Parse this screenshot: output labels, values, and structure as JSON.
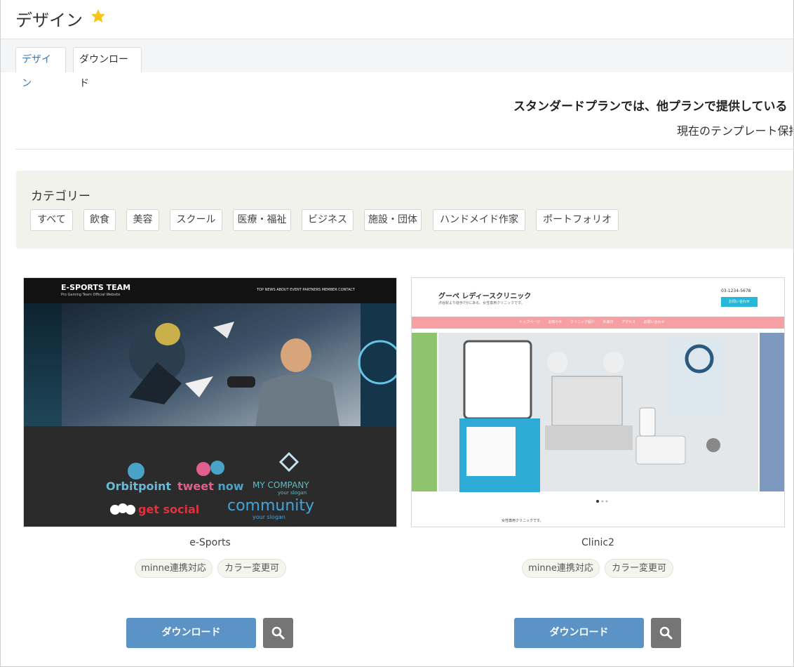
{
  "header": {
    "title": "デザイン",
    "star_icon": "star-icon",
    "star_color": "#f5c518"
  },
  "tabs": [
    {
      "label": "デザイン",
      "active": false
    },
    {
      "label": "ダウンロード",
      "active": true
    }
  ],
  "notice": {
    "line1": "スタンダードプランでは、他プランで提供している「有料",
    "line2": "現在のテンプレート保持"
  },
  "categories": {
    "title": "カテゴリー",
    "items": [
      "すべて",
      "飲食",
      "美容",
      "スクール",
      "医療・福祉",
      "ビジネス",
      "施設・団体",
      "ハンドメイド作家",
      "ポートフォリオ"
    ]
  },
  "templates": [
    {
      "name": "e-Sports",
      "tags": [
        "minne連携対応",
        "カラー変更可"
      ],
      "download_label": "ダウンロード",
      "search_icon": "search-icon",
      "preview": {
        "site_title": "E-SPORTS TEAM",
        "site_subtitle": "Pro Gaming Team Official Website",
        "nav": [
          "TOP",
          "NEWS",
          "ABOUT",
          "EVENT",
          "PARTNERS",
          "MEMBER",
          "CONTACT"
        ],
        "logos": {
          "orbitpoint": "Orbitpoint",
          "tweet": "tweet",
          "now": "now",
          "mycompany": "MY COMPANY",
          "mycompany_slogan": "your slogan",
          "getsocial": "get social",
          "community": "community",
          "community_slogan": "your slogan"
        }
      }
    },
    {
      "name": "Clinic2",
      "tags": [
        "minne連携対応",
        "カラー変更可"
      ],
      "download_label": "ダウンロード",
      "search_icon": "search-icon",
      "preview": {
        "site_title": "グーペ レディースクリニック",
        "site_subtitle": "渋谷駅より徒歩7分にある、女性専用クリニックです。",
        "phone": "03-1234-5678",
        "contact_btn": "お問い合わせ",
        "nav": [
          "トップページ",
          "お知らせ",
          "クリニック紹介",
          "外来日",
          "アクセス",
          "お問い合わせ"
        ],
        "body_heading": "女性専用クリニックです。"
      }
    }
  ]
}
